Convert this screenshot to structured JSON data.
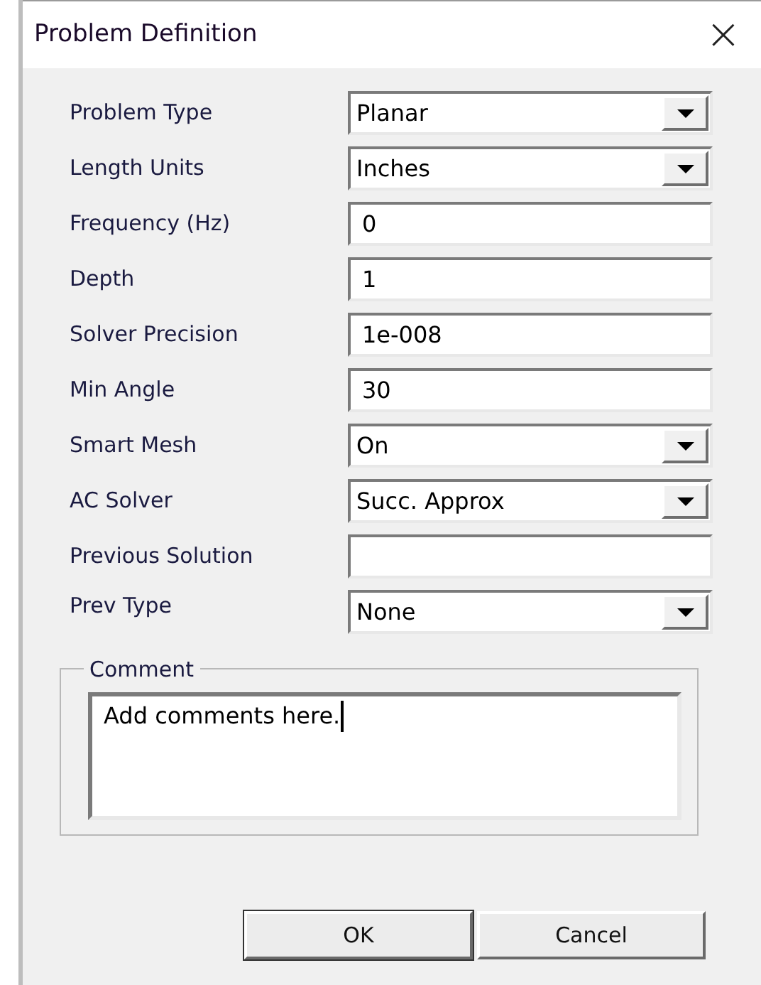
{
  "window": {
    "title": "Problem Definition",
    "close": "×"
  },
  "fields": [
    {
      "label": "Problem Type",
      "kind": "select",
      "value": "Planar"
    },
    {
      "label": "Length Units",
      "kind": "select",
      "value": "Inches"
    },
    {
      "label": "Frequency (Hz)",
      "kind": "text",
      "value": "0"
    },
    {
      "label": "Depth",
      "kind": "text",
      "value": "1"
    },
    {
      "label": "Solver Precision",
      "kind": "text",
      "value": "1e-008"
    },
    {
      "label": "Min Angle",
      "kind": "text",
      "value": "30"
    },
    {
      "label": "Smart Mesh",
      "kind": "select",
      "value": "On"
    },
    {
      "label": "AC Solver",
      "kind": "select",
      "value": "Succ. Approx"
    },
    {
      "label": "Previous Solution",
      "kind": "text"
    },
    {
      "label": "Prev Type",
      "kind": "select",
      "value": "None"
    }
  ],
  "comment": {
    "legend": "Comment",
    "value": "Add comments here."
  },
  "buttons": [
    {
      "label": "OK"
    },
    {
      "label": "Cancel"
    }
  ]
}
